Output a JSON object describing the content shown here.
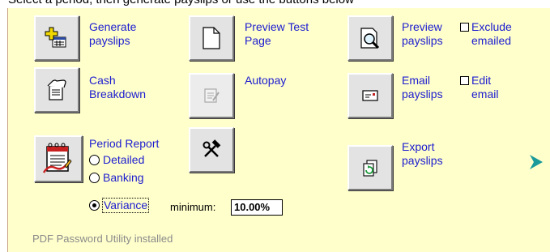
{
  "top_clipped_text": "Select a period, then generate payslips or use the buttons below",
  "buttons": {
    "generate_payslips": "Generate\npayslips",
    "preview_test_page": "Preview Test\nPage",
    "preview_payslips": "Preview\npayslips",
    "cash_breakdown": "Cash\nBreakdown",
    "autopay": "Autopay",
    "email_payslips": "Email\npayslips",
    "period_report": "Period Report",
    "export_payslips": "Export\npayslips"
  },
  "checkboxes": {
    "exclude_emailed": {
      "label": "Exclude\nemailed",
      "checked": false
    },
    "edit_email": {
      "label": "Edit\nemail",
      "checked": false
    }
  },
  "report_options": {
    "detailed": "Detailed",
    "banking": "Banking",
    "variance": "Variance",
    "selected": "variance"
  },
  "minimum": {
    "label": "minimum:",
    "value": "10.00%"
  },
  "status": "PDF Password Utility installed",
  "icons": {
    "generate": "add-payslip-icon",
    "preview_test": "blank-page-icon",
    "preview_payslips": "magnifier-page-icon",
    "cash_breakdown": "hand-document-icon",
    "autopay": "notepad-disabled-icon",
    "email": "envelope-icon",
    "period_report": "calendar-report-icon",
    "tools": "hammer-wrench-icon",
    "export": "export-refresh-icon",
    "next": "arrow-right-icon"
  },
  "colors": {
    "panel_background": "#ffffcc",
    "link_text": "#1c1cd0",
    "status_text": "#8a8a8a",
    "arrow": "#1a9a9a"
  }
}
